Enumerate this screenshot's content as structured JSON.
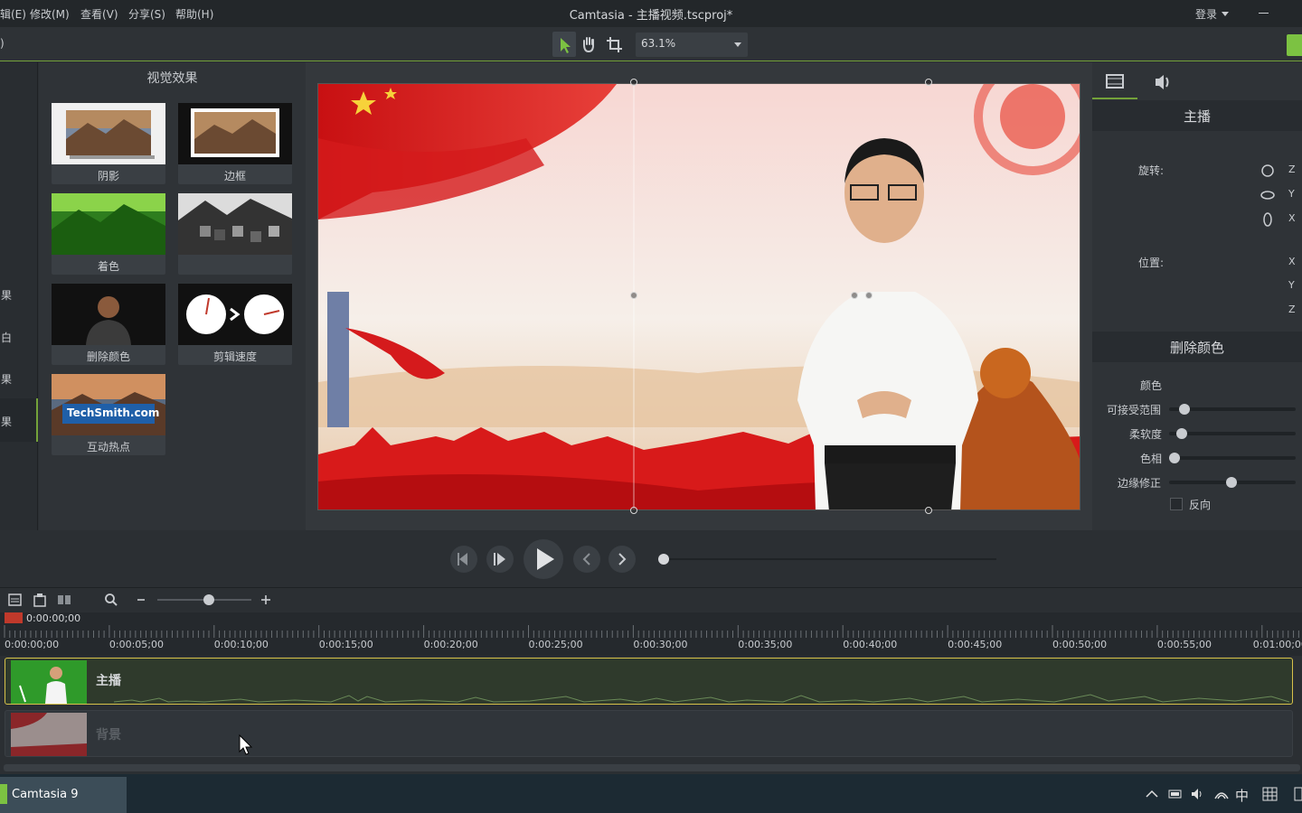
{
  "window": {
    "title": "Camtasia - 主播视频.tscproj*",
    "login_label": "登录"
  },
  "menu": [
    "辑(E)",
    "修改(M)",
    "查看(V)",
    "分享(S)",
    "帮助(H)"
  ],
  "toolbar": {
    "left_glyph": ")",
    "tools": [
      "select-arrow-icon",
      "hand-pan-icon",
      "crop-icon"
    ],
    "zoom_value": "63.1%"
  },
  "left_sidebar": {
    "items": [
      "果",
      "白",
      "果",
      "果"
    ],
    "active_index": 3
  },
  "effects_panel": {
    "title": "视觉效果",
    "effects": [
      {
        "label": "阴影"
      },
      {
        "label": "边框"
      },
      {
        "label": "着色"
      },
      {
        "label": ""
      },
      {
        "label": "删除颜色"
      },
      {
        "label": "剪辑速度"
      },
      {
        "label": "互动热点",
        "thumb_text": "TechSmith.com"
      }
    ]
  },
  "properties": {
    "tabs": [
      "film-icon",
      "speaker-icon"
    ],
    "clip_title": "主播",
    "rotation_label": "旋转:",
    "rotation_axes": [
      "Z",
      "Y",
      "X"
    ],
    "position_label": "位置:",
    "position_axes": [
      "X",
      "Y",
      "Z"
    ],
    "remove_color_title": "删除颜色",
    "color_label": "颜色",
    "sliders": [
      {
        "label": "可接受范围",
        "value": 0.12
      },
      {
        "label": "柔软度",
        "value": 0.1
      },
      {
        "label": "色相",
        "value": 0.04
      },
      {
        "label": "边缘修正",
        "value": 0.49
      }
    ],
    "invert_label": "反向"
  },
  "playback": {
    "buttons": [
      "step-back-icon",
      "step-forward-icon",
      "play-icon",
      "previous-icon",
      "next-icon"
    ],
    "progress": 0.0
  },
  "timeline": {
    "zoom_level": 0.55,
    "playhead_time": "0:00:00;00",
    "ruler_labels": [
      "0:00:00;00",
      "0:00:05;00",
      "0:00:10;00",
      "0:00:15;00",
      "0:00:20;00",
      "0:00:25;00",
      "0:00:30;00",
      "0:00:35;00",
      "0:00:40;00",
      "0:00:45;00",
      "0:00:50;00",
      "0:00:55;00",
      "0:01:00;00"
    ],
    "tracks": [
      {
        "label": "主播"
      },
      {
        "label": "背景"
      }
    ]
  },
  "taskbar": {
    "app_label": "Camtasia 9",
    "ime_label": "中"
  },
  "colors": {
    "accent": "#7cc242",
    "background": "#2b2f33",
    "panel": "#2f3337",
    "selected_clip_border": "#d8c24a"
  }
}
